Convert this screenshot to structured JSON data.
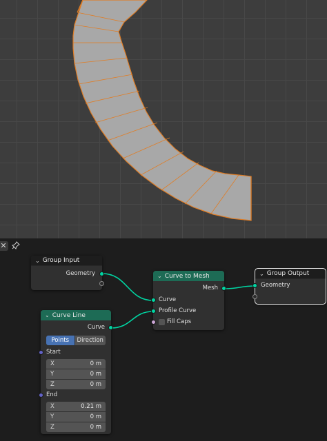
{
  "colors": {
    "geometry_socket": "#00d6a3",
    "vector_socket": "#6363c7",
    "boolean_socket": "#cca6d6",
    "geometry_header": "#1d6b55",
    "selected_button": "#4772b3",
    "mesh_fill": "#a8a8a8",
    "mesh_edge": "#e07d25"
  },
  "header": {
    "close_icon": "x-icon",
    "pin_icon": "pin-icon"
  },
  "nodes": {
    "group_input": {
      "title": "Group Input",
      "outputs": [
        "Geometry"
      ]
    },
    "curve_to_mesh": {
      "title": "Curve to Mesh",
      "output": "Mesh",
      "inputs": [
        "Curve",
        "Profile Curve"
      ],
      "fill_caps_label": "Fill Caps"
    },
    "group_output": {
      "title": "Group Output",
      "input": "Geometry"
    },
    "curve_line": {
      "title": "Curve Line",
      "output": "Curve",
      "mode_points": "Points",
      "mode_direction": "Direction",
      "start_label": "Start",
      "end_label": "End",
      "start": [
        {
          "axis": "X",
          "value": "0 m"
        },
        {
          "axis": "Y",
          "value": "0 m"
        },
        {
          "axis": "Z",
          "value": "0 m"
        }
      ],
      "end": [
        {
          "axis": "X",
          "value": "0.21 m"
        },
        {
          "axis": "Y",
          "value": "0 m"
        },
        {
          "axis": "Z",
          "value": "0 m"
        }
      ]
    }
  }
}
